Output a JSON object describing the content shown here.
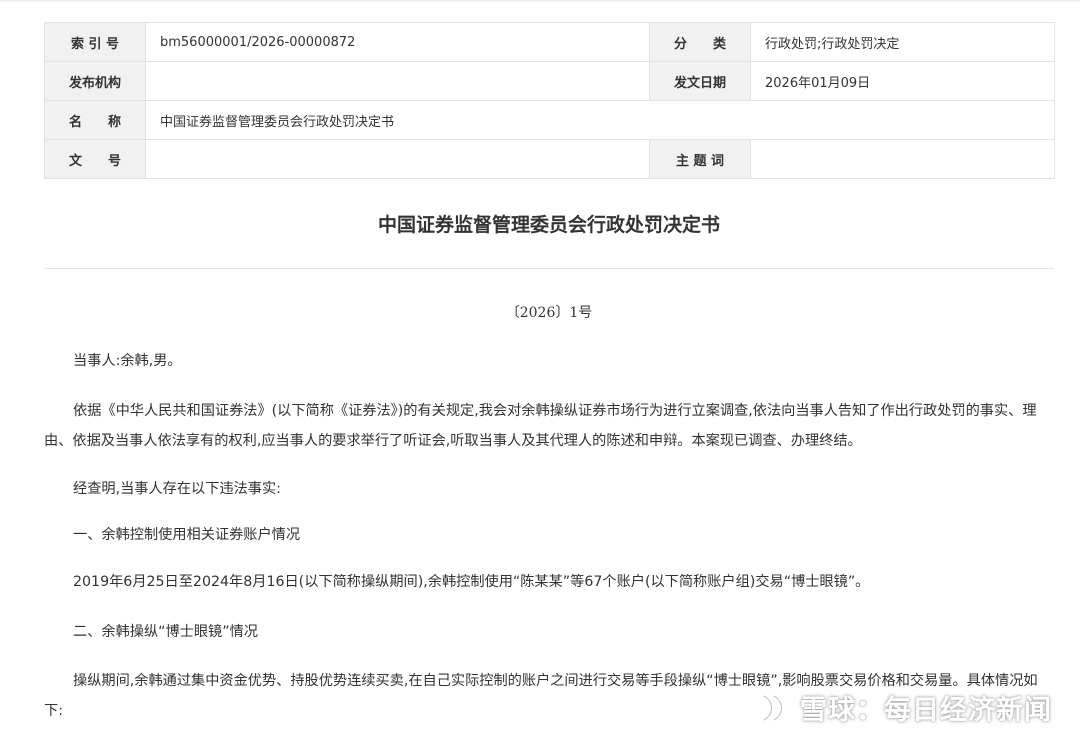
{
  "meta": {
    "index_label": "索 引 号",
    "index_value": "bm56000001/2026-00000872",
    "category_label": "分　　类",
    "category_value": "行政处罚;行政处罚决定",
    "publisher_label": "发布机构",
    "publisher_value": "",
    "date_label": "发文日期",
    "date_value": "2026年01月09日",
    "name_label": "名　　称",
    "name_value": "中国证券监督管理委员会行政处罚决定书",
    "docno_label": "文　　号",
    "docno_value": "",
    "subject_label": "主 题 词",
    "subject_value": ""
  },
  "document": {
    "title": "中国证券监督管理委员会行政处罚决定书",
    "number": "〔2026〕1号",
    "paragraphs": [
      "当事人:余韩,男。",
      "依据《中华人民共和国证券法》(以下简称《证券法》)的有关规定,我会对余韩操纵证券市场行为进行立案调查,依法向当事人告知了作出行政处罚的事实、理由、依据及当事人依法享有的权利,应当事人的要求举行了听证会,听取当事人及其代理人的陈述和申辩。本案现已调查、办理终结。",
      "经查明,当事人存在以下违法事实:",
      "一、余韩控制使用相关证券账户情况",
      "2019年6月25日至2024年8月16日(以下简称操纵期间),余韩控制使用“陈某某”等67个账户(以下简称账户组)交易“博士眼镜”。",
      "二、余韩操纵“博士眼镜”情况",
      "操纵期间,余韩通过集中资金优势、持股优势连续买卖,在自己实际控制的账户之间进行交易等手段操纵“博士眼镜”,影响股票交易价格和交易量。具体情况如下:"
    ]
  },
  "watermark": {
    "text": "雪球：每日经济新闻",
    "icon": "snowball-logo-icon"
  }
}
